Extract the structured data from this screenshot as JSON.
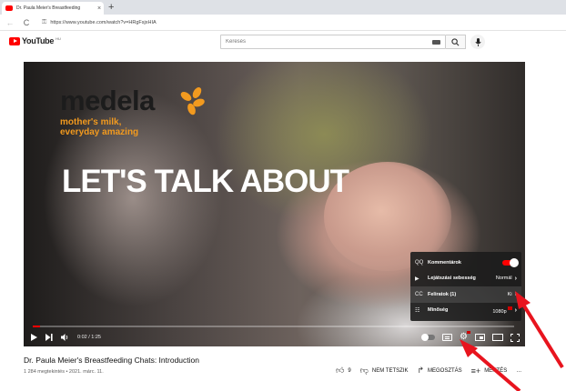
{
  "browser": {
    "tab_title": "Dr. Paula Meier's Breastfeeding",
    "tab_close": "×",
    "new_tab": "+",
    "back": "←",
    "reload": "C",
    "lock": "⚿",
    "url": "https://www.youtube.com/watch?v=HRgFsjxHIA"
  },
  "header": {
    "logo_text": "YouTube",
    "region": "HU",
    "search_placeholder": "Keresés"
  },
  "video": {
    "brand": "medela",
    "tagline_1": "mother's milk,",
    "tagline_2": "everyday amazing",
    "headline": "LET'S TALK ABOUT",
    "progress": 0.016
  },
  "settings_menu": {
    "items": [
      {
        "icon": "comments-icon",
        "glyph": "QQ",
        "label": "Kommentárok",
        "value": ""
      },
      {
        "icon": "playback-speed-icon",
        "glyph": "▶",
        "label": "Lejátszási sebesség",
        "value": "Normál"
      },
      {
        "icon": "subtitles-icon",
        "glyph": "CC",
        "label": "Feliratok (1)",
        "value": "Ki"
      },
      {
        "icon": "quality-icon",
        "glyph": "☷",
        "label": "Minőség",
        "value": "1080p"
      }
    ]
  },
  "controls": {
    "time": "0:02 / 1:25"
  },
  "info": {
    "title": "Dr. Paula Meier's Breastfeeding Chats: Introduction",
    "meta": "1 284 megtekintés • 2021. márc. 11.",
    "like_count": "9",
    "dislike_label": "NEM TETSZIK",
    "share_label": "MEGOSZTÁS",
    "save_label": "MENTÉS",
    "more": "…"
  },
  "colors": {
    "accent": "#ff0000",
    "brand_orange": "#f29a1f",
    "annotation_arrow": "#e8141e"
  }
}
